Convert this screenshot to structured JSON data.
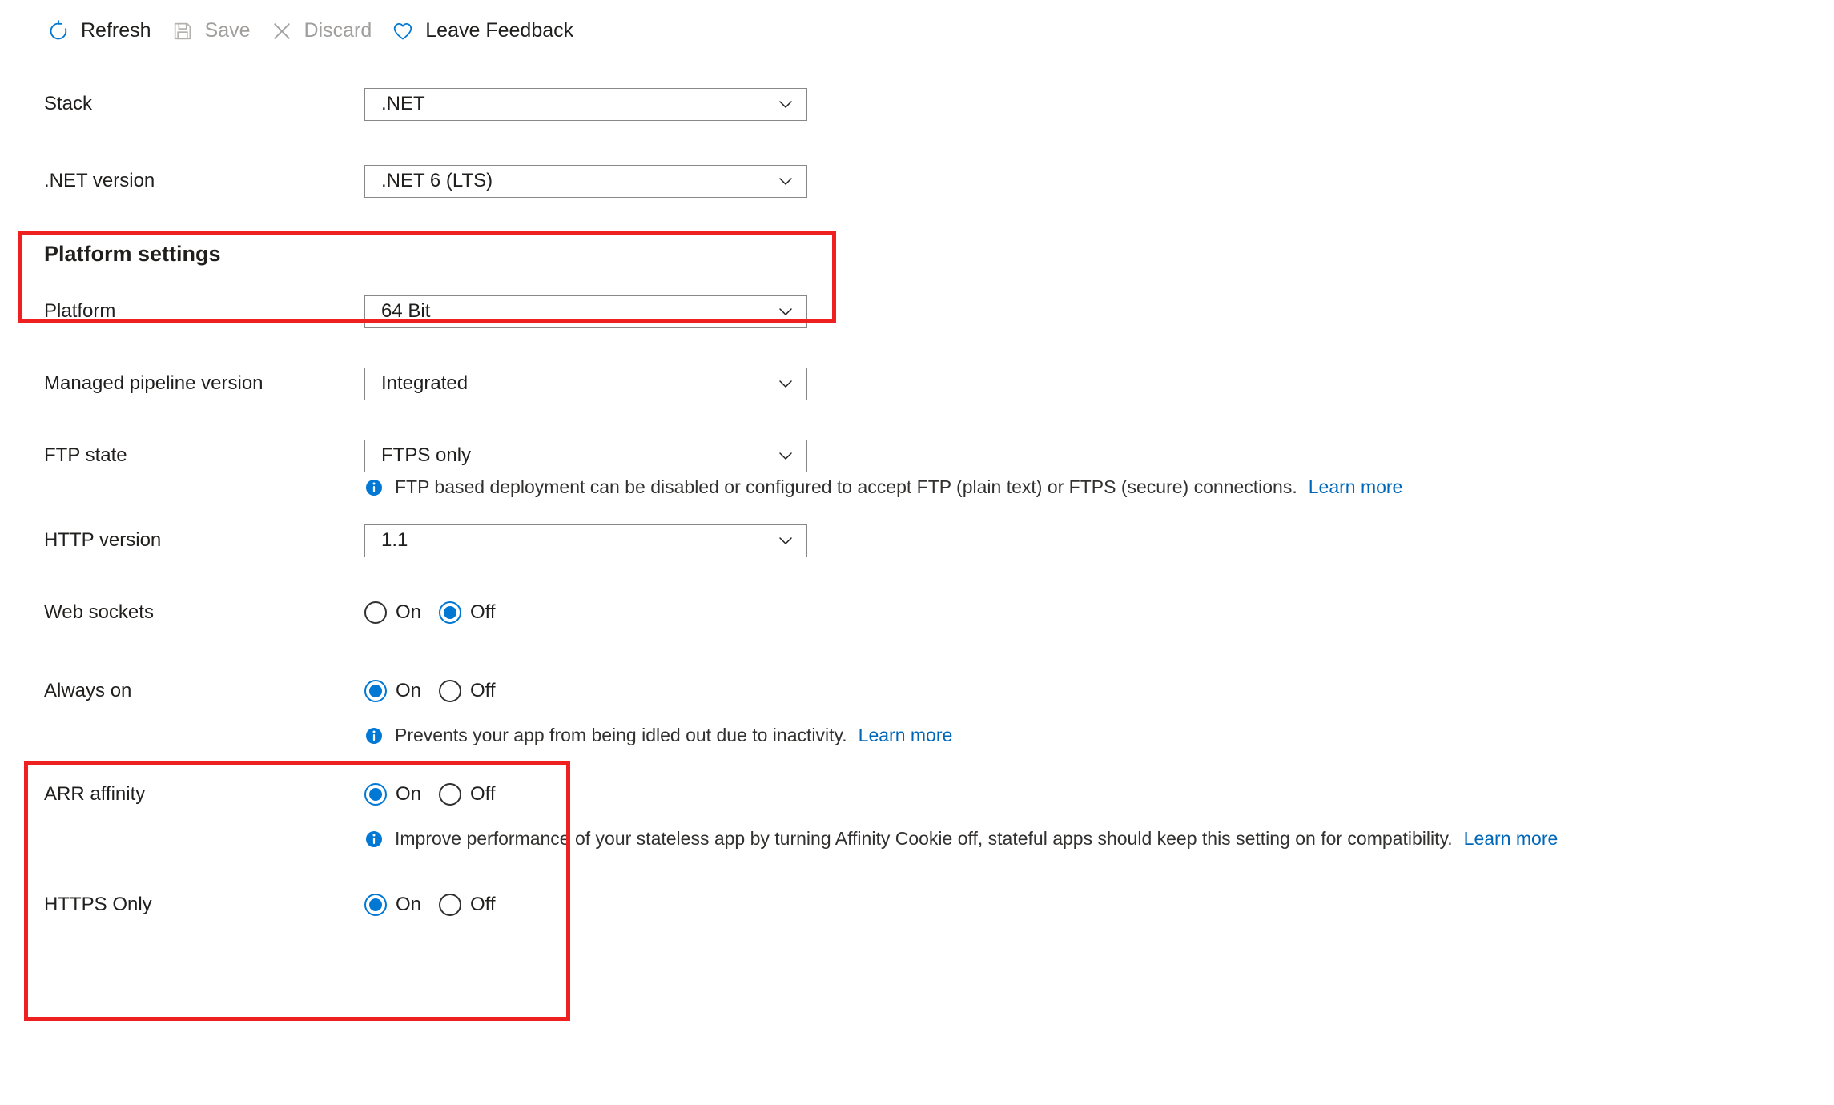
{
  "toolbar": {
    "buttons": [
      {
        "label": "Refresh",
        "icon": "refresh-icon",
        "disabled": false
      },
      {
        "label": "Save",
        "icon": "save-icon",
        "disabled": true
      },
      {
        "label": "Discard",
        "icon": "discard-icon",
        "disabled": true
      },
      {
        "label": "Leave Feedback",
        "icon": "heart-icon",
        "disabled": false
      }
    ]
  },
  "stack_section": {
    "stack_label": "Stack",
    "stack_value": ".NET",
    "dotnet_version_label": ".NET version",
    "dotnet_version_value": ".NET 6 (LTS)"
  },
  "platform_settings": {
    "heading": "Platform settings",
    "platform": {
      "label": "Platform",
      "value": "64 Bit"
    },
    "managed_pipeline": {
      "label": "Managed pipeline version",
      "value": "Integrated"
    },
    "ftp_state": {
      "label": "FTP state",
      "value": "FTPS only",
      "info": "FTP based deployment can be disabled or configured to accept FTP (plain text) or FTPS (secure) connections.",
      "info_link": "Learn more"
    },
    "http_version": {
      "label": "HTTP version",
      "value": "1.1"
    },
    "web_sockets": {
      "label": "Web sockets",
      "on_label": "On",
      "off_label": "Off",
      "selected": "Off"
    },
    "always_on": {
      "label": "Always on",
      "on_label": "On",
      "off_label": "Off",
      "selected": "On",
      "info": "Prevents your app from being idled out due to inactivity.",
      "info_link": "Learn more"
    },
    "arr_affinity": {
      "label": "ARR affinity",
      "on_label": "On",
      "off_label": "Off",
      "selected": "On",
      "info": "Improve performance of your stateless app by turning Affinity Cookie off, stateful apps should keep this setting on for compatibility.",
      "info_link": "Learn more"
    },
    "https_only": {
      "label": "HTTPS Only",
      "on_label": "On",
      "off_label": "Off",
      "selected": "On"
    }
  },
  "colors": {
    "accent": "#0078d4",
    "link": "#0067b8",
    "annotation": "#ef2020",
    "text": "#201f1e",
    "disabled_text": "#a19f9d"
  }
}
